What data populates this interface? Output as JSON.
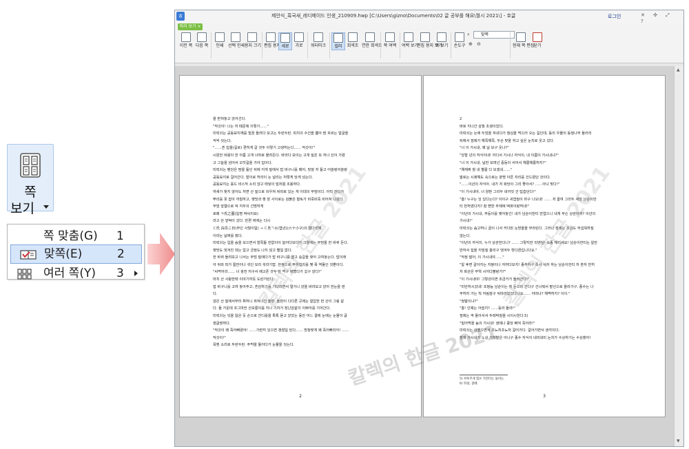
{
  "callout": {
    "button": {
      "line1": "쪽",
      "line2": "보기"
    },
    "menu": [
      {
        "label": "쪽 맞춤(G)",
        "number": "1"
      },
      {
        "label": "맞쪽(E)",
        "number": "2"
      },
      {
        "label": "여러 쪽(Y)",
        "number": "3"
      }
    ]
  },
  "app": {
    "title": "제안식_흑국새_레디메이드 인생_210909.hwp [C:\\Users\\gizno\\Documents\\02 글 공부를 해요\\월시 2021\\] - 호글",
    "login": "로그인",
    "tab": "미리 보기 ×",
    "ribbon": [
      {
        "name": "prev-page-button",
        "label": "이전 쪽"
      },
      {
        "name": "next-page-button",
        "label": "다음 쪽"
      },
      {
        "name": "print-button",
        "label": "인쇄"
      },
      {
        "name": "select-print-button",
        "label": "선택 인쇄"
      },
      {
        "name": "paper-size-button",
        "label": "용지 크기"
      },
      {
        "name": "edit-paper-button",
        "label": "편집 용지"
      },
      {
        "name": "portrait-button",
        "label": "세로"
      },
      {
        "name": "landscape-button",
        "label": "가로"
      },
      {
        "name": "watermark-button",
        "label": "워터마크"
      },
      {
        "name": "color-button",
        "label": "컬러"
      },
      {
        "name": "gray-button",
        "label": "회색조"
      },
      {
        "name": "fade-button",
        "label": "연한 회색조"
      },
      {
        "name": "page-margin-button",
        "label": "쪽 여백"
      },
      {
        "name": "margin-view-button",
        "label": "여백 보기"
      },
      {
        "name": "edit-paper-view-button",
        "label": "편집 용지 보기"
      },
      {
        "name": "page-view-button",
        "label": "쪽 보기"
      },
      {
        "name": "hand-tool-button",
        "label": "손도구"
      },
      {
        "name": "current-page-edit-button",
        "label": "현재 쪽 편집"
      },
      {
        "name": "close-button",
        "label": "닫기"
      }
    ],
    "zoom": "맞쪽"
  },
  "left_page": {
    "lines": [
      "을 받혀놓고 앉어선다.",
      "  \"작갓이! 나는 저 때문에 이렇가……\"",
      "  미럭쇠는 공동묘지께를 힐끔 돌려다 보고는 두런두런. 피치의 수건을 뽑아 땀 흐르는 얼굴을",
      "씩씩 씻는다.",
      "  \"……흔 집을(길로) 편히게 갈 것두 이렇기 고생허는디…… 작갓이!\"",
      "  시원한 바람이 한 아름 고개 너머로 몰려든다. 바라다 보이는 고개 밑은 또 하나 산이 가렸",
      "고 그늘을 넘어서 오밋길을 가야 집이다.",
      "  미럭쇠는 팬던은 땀을 들인 뒤에 지게 밑에서 밥 바구니를 떼어, 핏잖 저 들고 어슬렁어슬렁",
      "공동묘지로 걸어간다. 할이로 허리이 눈 널리는 처렇게 당게 넘는다.",
      "  공동묘지는 홀드 비스작 소리 않고 태넣이 빌처럼 조용하다.",
      "  여새가 찾지 않아도 처면 산 밑으로 외우쳐 뒤따로 있는 게 이데의 무덤이다. 아직 잔디가",
      "뿌리를 못 잡아 까칠하고, 햇맛과 햇 장 사이로는 검붉은 황토가 비죽비죽 비어져 나왔다.",
      "  무덤 앞엘으로 억 지두의 선명하게",
      "  로페 ㅋ氏之墓(일명 박씨지묘)",
      "  라고 쓴 앞떡이 섰다. 한편 찌에는 다시",
      "  ㄷ氏 白丹ニ日(무인 사월이일)        →  ㄷ氏ㄱ소(엽년)(六十小구)의 엘다섯해.",
      "  이라는 날짜를 했다.",
      "  미럭쇠는 입을 숨을 모으면서 할쪽들 한없이이 늘어다보다가 그렇에는 무덤을 한 바퀴 돈다.",
      "  햇맛도 벗겨진 데는 없고 긍정도 나지 않고 별일 없다.",
      "  한 바퀴 돌려보고 나서는 무덤 밑에다가 밥 바구니를 열고 숭갈을 찾아 고여놓는다. 밥이래",
      "야 뒤와 피가 절반이나 섞인 보리 섞라기밥. 한쌍으로 푸하집치를 몇 폭 역둘인 것뿐이다.",
      "  \"씨먹어라…… 너 생전 저구서 배고픈 것두 만 먹구 매쩠다가 갔구 않다!\"",
      "  마치 산 사람한테 이야기하듯 도란거린다.",
      "  밥 바구니를 고여 놓아주고, 흔감하기를 기다리면서 멀거니 앉을 바라보고 앉아 한눈을 판",
      "다.",
      "  않은 산 밑에서부터 휘하니 퍼져나간 들판. 들판이 다다른 곳에는 얼압한 먼 산이 그림 같",
      "다. 들 가운데 조그마한 산모롱이를 지나 기차가 장난감같이 이쁘어를 기어간다.",
      "  미럭쇠는 넋을 잃은 듯 손으로 잔디를을 톡톡 뜯고 앉았는 동안 어느 결에 눈에는 눈물이 글",
      "썽글썽하다.",
      "  \"작갓이 왜 죽어뻐렸어! ……가련히 있으면 갱찮일 틴다…… 방정맞게 왜 죽어뻐리어! ……",
      "작갓이!\"",
      "  목맨 소리로 두런두런. 주먹을 들어다가 눈물을 씻는다."
    ],
    "page_number": "2"
  },
  "right_page": {
    "lines": [
      "  2",
      "  바로 지나간 삼월 초생이었다.",
      "  미럭쇠는 논에 두엄을 져내다가 첨심을 먹으러 오는 길인데, 동리 우물의 동청나무 둘러리",
      "뒤에서 점례가 해쪽해쪽, 두손 맞을 하고 싶은 눈치로 웃고 섰다.",
      "  \"너 이 가시내, 왜 날 보구 웃나?\"",
      "  \"앙할 년의 작식이네! 어디서 가시나 자식이, 내 이름이 가시내냐?\"",
      "  \"너 이 가시내, 날만 보며넌 중둥이 서어서 해롱해롱허지?\"",
      "  \"예재짜 참 내 별꼴 다 보겠네……\"",
      "  말로는 시쾌해도 속으로는 분명 아픈 자리를 건드렸던 것이다.",
      "  \"……이년의 자식아. 내가 저 화당이 그리 좋아서? ……아냐 맞다!\"",
      "  \"이 가시내야, 너 양판 그리두 네까짓 건 밉습던다!\"",
      "  \"흥! 누구는 잉 있다는다? 아이구 귀엽질이 마구 나오네! …… 저 꼴여 그리두 새앙 남순이만",
      "티 번하였다지? 참 뻔한 주제에 떡파이랑허네!\"",
      "  \"이년의 가시내, 주둥이를 찢어놓긴! 내가 남순이한티 반엽으니 네게 무슨 상관이여? 이년의",
      "가시내!\"",
      "  미럭쇠는 숨고허니 골이 나서 커다란 눈방울을 부라린다. 그러나 점례는 조금도 무섭워하질",
      "않는다.",
      "  \"이년의 자식이, 누가 상관헌다니? …… 그렇지만 되엔님! 속종 채리세요! 남순이한티는 알만",
      "반하서 힘을 지밈질 흥리구 댕겨두 헛다끔입니다요.\"",
      "  \"작정 말어, 이 가시내야……\"",
      "  \"알 후면 갈아지는 지팡이나 자여다보지! 종추하구 족사 사자 하는 남순이한티 저 혼자 반히",
      "저 화끈은 부엌 시어다볼랑가?\"",
      "  \"이 가시내야! 그렇겅이면 조금거가 들어간다!\"",
      "  \"미안허시겄네! 조벙능 남순이는 취 돈으리 간다구 건너뭐서 팥산으로 올라가구. 종수는 나",
      "무허러 가는 척 어림잖구 뒤따라갔겄다나요…… 어떠냐? 해쩍허지? 이이.\"",
      "  \"정말이냐?\"",
      "  \"흥! 인제는 아숩지? ……등라 들라!\"",
      "  점례는 싹 돌아서서 두레박질을 시이시한다.5)",
      "  \"빌어먹을 놈의 가시내! 생에나 풍당 빠져 죽어라!\"",
      "  미럭쇠는 내뱉으면서 초뇨처초뇨처 걸어가다. 걸어가면서 생각이다.",
      "  점례 가시내가 노상 거짓말은 아니구 종수 자식이 네미네미 눈치가 수상하기는 수상했어!"
    ],
    "footnotes": [
      "5) 서투르게 힘쓰 가한다는 들이는.",
      "6) 뒤섞, 걸례."
    ],
    "page_number": "3"
  },
  "watermark": "칼렉의 한글 2021"
}
